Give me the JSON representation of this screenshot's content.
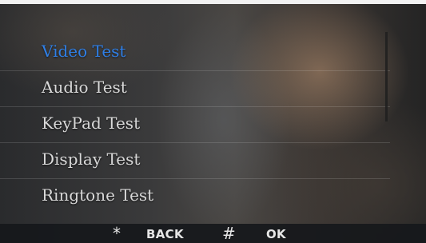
{
  "menu": {
    "items": [
      {
        "label": "Video Test",
        "selected": true
      },
      {
        "label": "Audio Test",
        "selected": false
      },
      {
        "label": "KeyPad Test",
        "selected": false
      },
      {
        "label": "Display Test",
        "selected": false
      },
      {
        "label": "Ringtone Test",
        "selected": false
      }
    ]
  },
  "footer": {
    "back_key": "*",
    "back_label": "BACK",
    "ok_key": "#",
    "ok_label": "OK"
  },
  "colors": {
    "selected_item": "#2f7fe6",
    "item_text": "#d9d9d9",
    "footer_bg": "#16181b"
  }
}
